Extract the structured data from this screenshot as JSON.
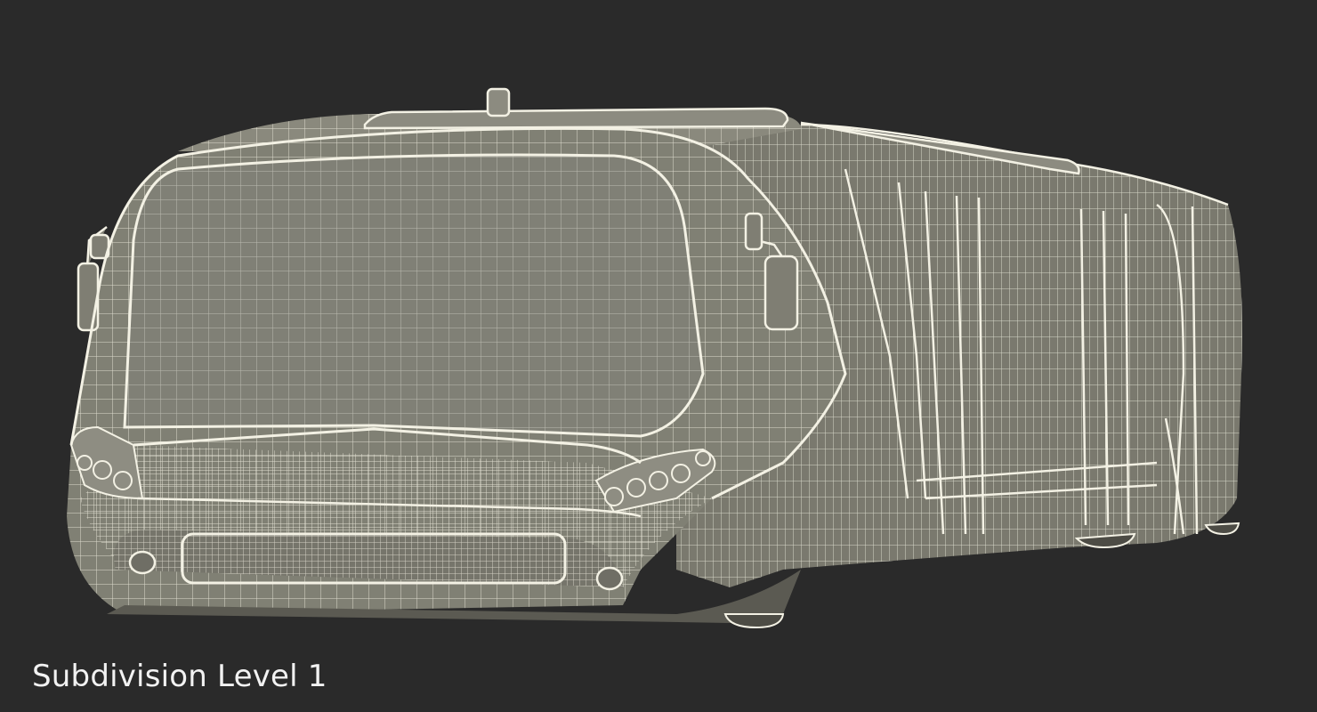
{
  "caption": "Subdivision Level 1",
  "colors": {
    "background": "#2a2a2a",
    "body_fill": "#7e7d72",
    "wire": "#f1efe2"
  }
}
